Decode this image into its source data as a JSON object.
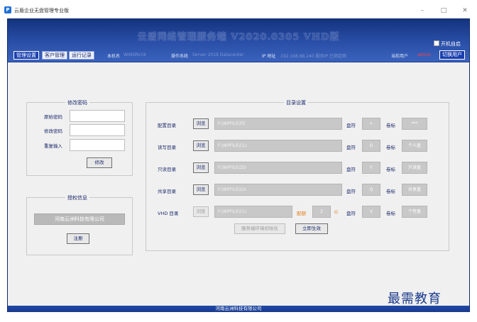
{
  "window": {
    "icon_letter": "P",
    "title": "云盾企业无盘管理专业版",
    "minimize": "–",
    "maximize": "□",
    "close": "✕"
  },
  "header": {
    "title": "云盾网络管理服务端 V2020.0305 VHD版",
    "boot_label": "开机自启",
    "tabs": [
      {
        "label": "管理设置",
        "active": true
      },
      {
        "label": "客户管理",
        "active": false
      },
      {
        "label": "运行记录",
        "active": false
      }
    ],
    "machine_label": "本机名",
    "machine_value": "WINSRV19",
    "os_label": "操作系统",
    "os_value": "Server 2019 Datacenter",
    "ip_label": "IP 地址",
    "ip_value": "192.168.88.240 服务IP 已绑定网",
    "user_label": "当前用户",
    "user_value": "admin",
    "switch_user": "切换用户"
  },
  "password_panel": {
    "legend": "修改密码",
    "old_label": "原始密码",
    "new_label": "修改密码",
    "repeat_label": "重复输入",
    "old_value": "",
    "new_value": "",
    "repeat_value": "",
    "modify_button": "修改"
  },
  "license_panel": {
    "legend": "授权信息",
    "company": "河南云洲科技有限公司",
    "register_button": "注册"
  },
  "directory_panel": {
    "legend": "目录设置",
    "browse": "浏览",
    "drive_label": "盘符",
    "volume_label": "卷标",
    "rows": [
      {
        "label": "配置目录",
        "path": "F:\\WPFILE\\PZ",
        "drive": "+",
        "volume": "***",
        "browse_enabled": true
      },
      {
        "label": "读写目录",
        "path": "F:\\WPFILE\\CLI",
        "drive": "O",
        "volume": "个人盘",
        "browse_enabled": true
      },
      {
        "label": "只读目录",
        "path": "F:\\WPFILE\\ZD",
        "drive": "Y",
        "volume": "只读盘",
        "browse_enabled": true
      },
      {
        "label": "共享目录",
        "path": "F:\\WPFILE\\GX",
        "drive": "Q",
        "volume": "共享盘",
        "browse_enabled": true
      },
      {
        "label": "VHD 目录",
        "path": "F:\\WPFILE\\CLI",
        "drive": "V",
        "volume": "个性盘",
        "browse_enabled": false
      }
    ],
    "vhd_quota_label": "配额",
    "vhd_quota_value": "2",
    "vhd_quota_unit": "G",
    "init_button": "服务端环境初始化",
    "apply_button": "立即生效"
  },
  "footer": {
    "text": "河南云洲科技有限公司"
  },
  "watermark": "最需教育",
  "colors": {
    "frame": "#1a3a8c",
    "content_bg": "#f0f0f0",
    "active_tab": "#1b3fb0",
    "text": "#1b2a6b",
    "accent_red": "#ff4040",
    "quota_orange": "#e07a1a"
  }
}
